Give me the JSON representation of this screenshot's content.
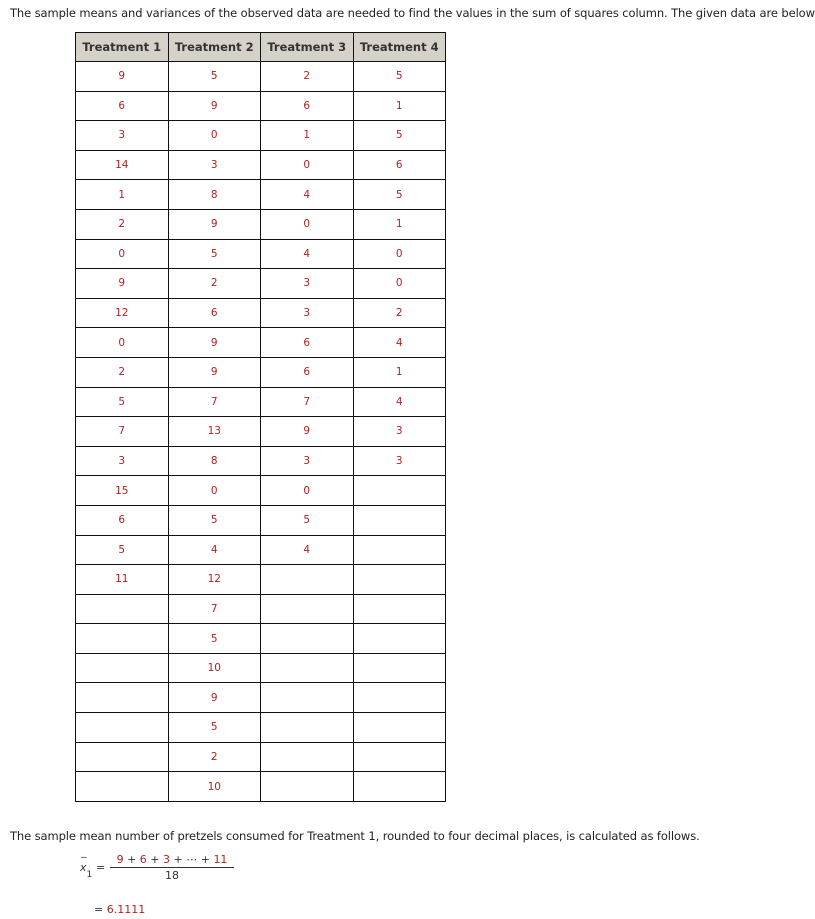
{
  "intro_text": "The sample means and variances of the observed data are needed to find the values in the sum of squares column. The given data are below.",
  "table": {
    "headers": [
      "Treatment 1",
      "Treatment 2",
      "Treatment 3",
      "Treatment 4"
    ],
    "rows": [
      [
        "9",
        "5",
        "2",
        "5"
      ],
      [
        "6",
        "9",
        "6",
        "1"
      ],
      [
        "3",
        "0",
        "1",
        "5"
      ],
      [
        "14",
        "3",
        "0",
        "6"
      ],
      [
        "1",
        "8",
        "4",
        "5"
      ],
      [
        "2",
        "9",
        "0",
        "1"
      ],
      [
        "0",
        "5",
        "4",
        "0"
      ],
      [
        "9",
        "2",
        "3",
        "0"
      ],
      [
        "12",
        "6",
        "3",
        "2"
      ],
      [
        "0",
        "9",
        "6",
        "4"
      ],
      [
        "2",
        "9",
        "6",
        "1"
      ],
      [
        "5",
        "7",
        "7",
        "4"
      ],
      [
        "7",
        "13",
        "9",
        "3"
      ],
      [
        "3",
        "8",
        "3",
        "3"
      ],
      [
        "15",
        "0",
        "0",
        ""
      ],
      [
        "6",
        "5",
        "5",
        ""
      ],
      [
        "5",
        "4",
        "4",
        ""
      ],
      [
        "11",
        "12",
        "",
        ""
      ],
      [
        "",
        "7",
        "",
        ""
      ],
      [
        "",
        "5",
        "",
        ""
      ],
      [
        "",
        "10",
        "",
        ""
      ],
      [
        "",
        "9",
        "",
        ""
      ],
      [
        "",
        "5",
        "",
        ""
      ],
      [
        "",
        "2",
        "",
        ""
      ],
      [
        "",
        "10",
        "",
        ""
      ]
    ]
  },
  "summary_text": "The sample mean number of pretzels consumed for Treatment 1, rounded to four decimal places, is calculated as follows.",
  "formula": {
    "symbol": "x",
    "bar": "‾",
    "subscript": "1",
    "equals": "=",
    "numerator_terms": [
      "9",
      "6",
      "3",
      "⋯",
      "11"
    ],
    "numerator_operator": "+",
    "denominator": "18",
    "result_equals": "=",
    "result": "6.1111"
  },
  "colors": {
    "data_value": "#b22222",
    "header_bg": "#d6d2c9",
    "border": "#111111"
  }
}
